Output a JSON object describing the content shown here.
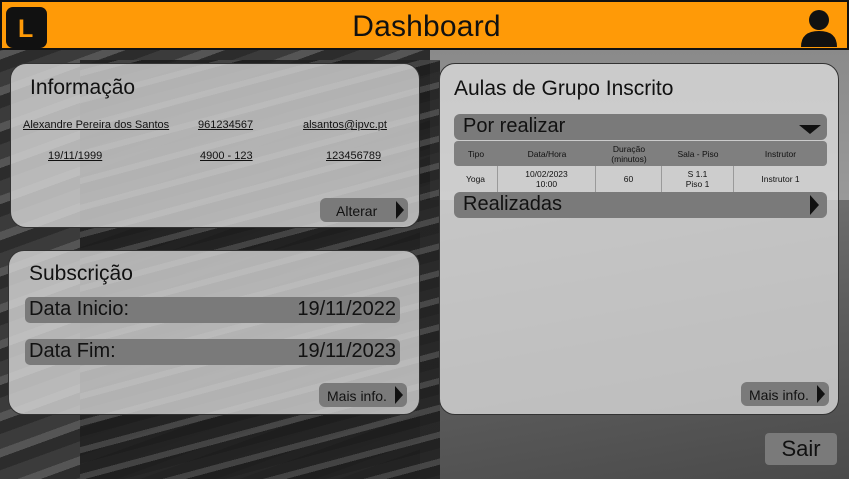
{
  "header": {
    "logo_letter": "L",
    "title": "Dashboard",
    "user_icon": "user-icon",
    "accent_color": "#ff9a07"
  },
  "info": {
    "title": "Informação",
    "name": "Alexandre Pereira dos Santos",
    "phone": "961234567",
    "email": "alsantos@ipvc.pt",
    "birthdate": "19/11/1999",
    "postal_code": "4900 - 123",
    "id_number": "123456789",
    "alter_button": "Alterar"
  },
  "subscription": {
    "title": "Subscrição",
    "start_label": "Data Inicio:",
    "start_value": "19/11/2022",
    "end_label": "Data Fim:",
    "end_value": "19/11/2023",
    "more_button": "Mais info."
  },
  "classes": {
    "title": "Aulas de Grupo Inscrito",
    "pending_label": "Por realizar",
    "done_label": "Realizadas",
    "more_button": "Mais info.",
    "table": {
      "headers": [
        "Tipo",
        "Data/Hora",
        "Duração\n(minutos)",
        "Sala - Piso",
        "Instrutor"
      ],
      "rows": [
        [
          "Yoga",
          "10/02/2023\n10:00",
          "60",
          "S 1.1\nPiso 1",
          "Instrutor 1"
        ]
      ]
    }
  },
  "exit_button": "Sair"
}
